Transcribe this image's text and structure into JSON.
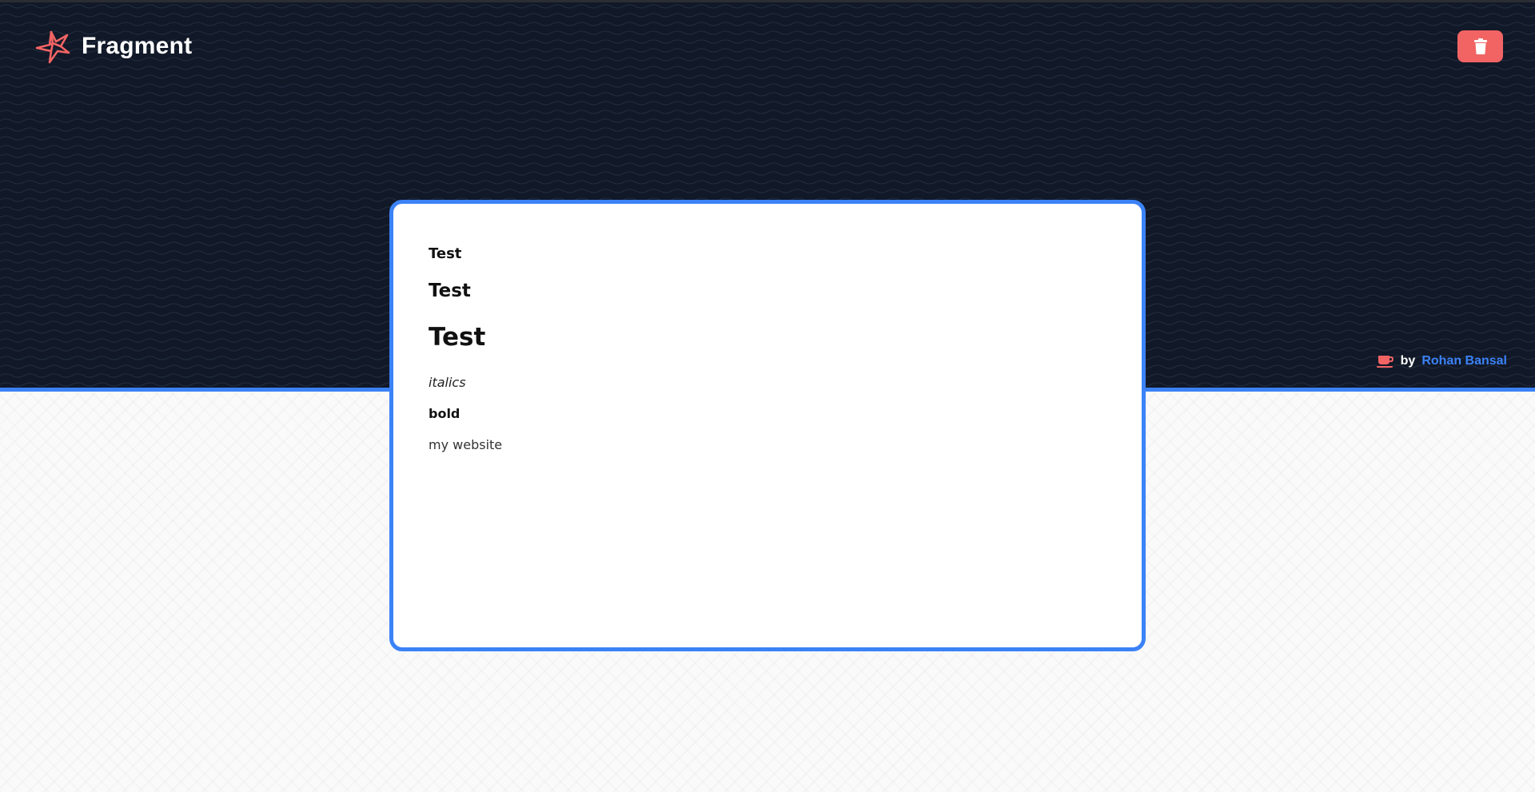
{
  "app": {
    "name": "Fragment",
    "logo_icon": "fragment-logo-icon",
    "accent_color": "#3b82f6",
    "danger_color": "#f26464",
    "header_bg": "#111827"
  },
  "toolbar": {
    "delete_icon": "trash-icon"
  },
  "credit": {
    "icon": "coffee-cup-icon",
    "by_label": "by",
    "author": "Rohan Bansal"
  },
  "document": {
    "heading_small": "Test",
    "heading_medium": "Test",
    "heading_large": "Test",
    "italic_text": "italics",
    "bold_text": "bold",
    "link_text": "my website"
  }
}
